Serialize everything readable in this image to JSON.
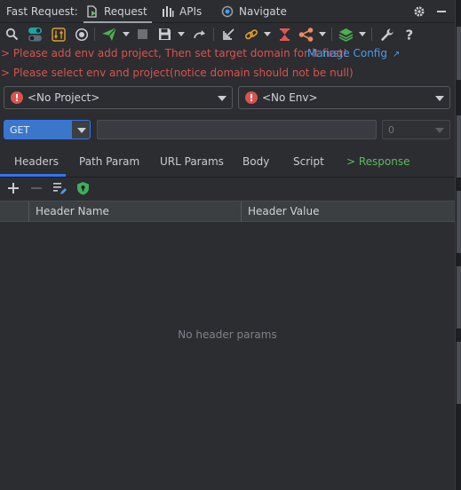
{
  "title_bar": {
    "app_title": "Fast Request:",
    "tabs": [
      {
        "label": "Request",
        "icon": "request-icon",
        "active": true
      },
      {
        "label": "APIs",
        "icon": "apis-icon",
        "active": false
      },
      {
        "label": "Navigate",
        "icon": "navigate-icon",
        "active": false
      }
    ],
    "actions": [
      "gear-icon",
      "minimize-icon"
    ]
  },
  "toolbar": {
    "icons": [
      "search-icon",
      "toggle-icon",
      "settings-sliders-icon",
      "target-icon",
      "send-icon",
      "stop-icon",
      "save-icon",
      "redo-icon",
      "import-icon",
      "link-icon",
      "hourglass-icon",
      "share-icon",
      "layers-icon",
      "wrench-icon",
      "help-icon"
    ]
  },
  "warnings": {
    "line1": "> Please add env add project, Then set target domain for it first!",
    "manage_config": "Manage Config",
    "line2": "> Please select env and project(notice domain should not be null)"
  },
  "selectors": {
    "project": "<No Project>",
    "env": "<No Env>"
  },
  "request": {
    "method": "GET",
    "url": "",
    "env_index": "0"
  },
  "tabs": [
    {
      "label": "Headers",
      "active": true
    },
    {
      "label": "Path Param",
      "active": false
    },
    {
      "label": "URL Params",
      "active": false
    },
    {
      "label": "Body",
      "active": false
    },
    {
      "label": "Script",
      "active": false
    },
    {
      "label": "> Response",
      "active": false
    }
  ],
  "headers_table": {
    "columns": [
      "Header Name",
      "Header Value"
    ],
    "empty_text": "No header params"
  },
  "colors": {
    "background": "#2b2d30",
    "accent": "#3574f0",
    "error": "#d9534f",
    "link": "#4d9ae8",
    "success": "#5fb85f"
  }
}
